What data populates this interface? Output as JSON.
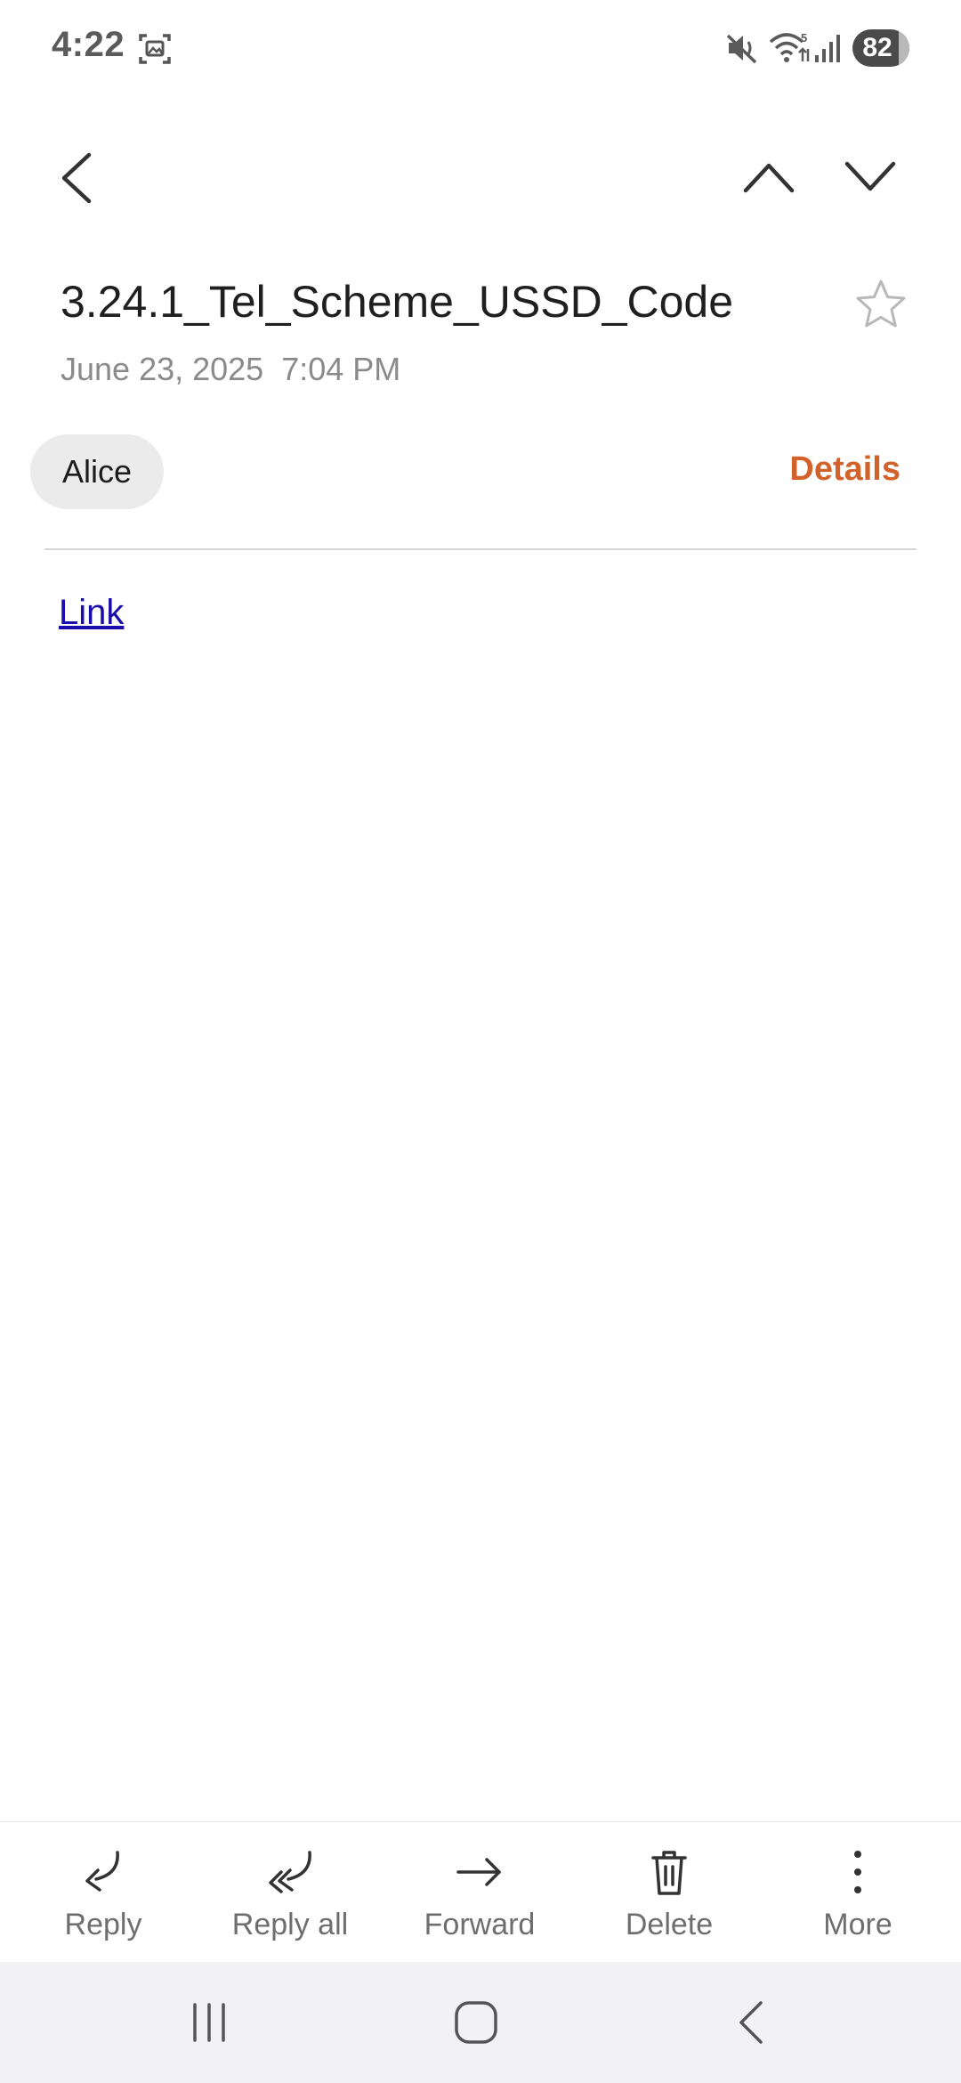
{
  "status_bar": {
    "time": "4:22",
    "battery": "82",
    "icons": [
      "screenshot-icon",
      "mute-icon",
      "wifi-icon",
      "signal-icon",
      "battery-icon"
    ]
  },
  "toolbar": {
    "back_icon": "chevron-left-icon",
    "prev_icon": "chevron-up-icon",
    "next_icon": "chevron-down-icon"
  },
  "email": {
    "subject": "3.24.1_Tel_Scheme_USSD_Code",
    "date": "June 23, 2025  7:04 PM",
    "sender": "Alice",
    "details_label": "Details",
    "body_link": "Link",
    "starred": false
  },
  "actions": [
    {
      "label": "Reply",
      "icon": "reply-icon"
    },
    {
      "label": "Reply all",
      "icon": "reply-all-icon"
    },
    {
      "label": "Forward",
      "icon": "forward-icon"
    },
    {
      "label": "Delete",
      "icon": "trash-icon"
    },
    {
      "label": "More",
      "icon": "more-vertical-icon"
    }
  ],
  "colors": {
    "accent": "#d2622a",
    "link": "#1a0dab",
    "nav_bar_bg": "#f2f2f4"
  }
}
